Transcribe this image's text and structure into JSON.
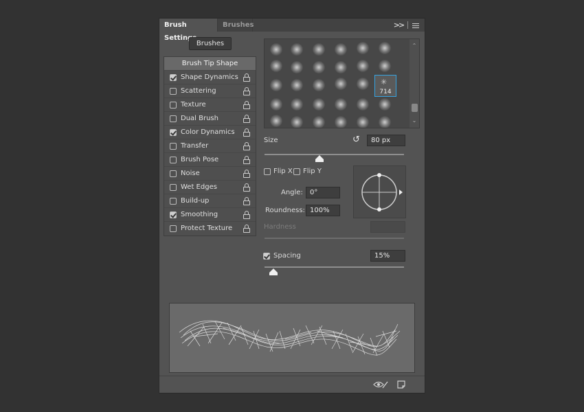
{
  "tabs": {
    "active": "Brush Settings",
    "inactive": "Brushes"
  },
  "brushes_button": "Brushes",
  "options_header": "Brush Tip Shape",
  "options": [
    {
      "label": "Shape Dynamics",
      "checked": true
    },
    {
      "label": "Scattering",
      "checked": false
    },
    {
      "label": "Texture",
      "checked": false
    },
    {
      "label": "Dual Brush",
      "checked": false
    },
    {
      "label": "Color Dynamics",
      "checked": true
    },
    {
      "label": "Transfer",
      "checked": false
    },
    {
      "label": "Brush Pose",
      "checked": false
    },
    {
      "label": "Noise",
      "checked": false
    },
    {
      "label": "Wet Edges",
      "checked": false
    },
    {
      "label": "Build-up",
      "checked": false
    },
    {
      "label": "Smoothing",
      "checked": true
    },
    {
      "label": "Protect Texture",
      "checked": false
    }
  ],
  "selected_tip": "714",
  "size": {
    "label": "Size",
    "value": "80 px"
  },
  "flip": {
    "x_label": "Flip X",
    "y_label": "Flip Y",
    "x_checked": false,
    "y_checked": false
  },
  "angle": {
    "label": "Angle:",
    "value": "0°"
  },
  "roundness": {
    "label": "Roundness:",
    "value": "100%"
  },
  "hardness": {
    "label": "Hardness",
    "value": ""
  },
  "spacing": {
    "label": "Spacing",
    "value": "15%",
    "checked": true
  },
  "icons": {
    "collapse": "double-chevron-right-icon",
    "menu": "hamburger-menu-icon",
    "reset": "reset-icon",
    "lock": "lock-icon",
    "toggle_preview": "eye-icon",
    "new_preset": "new-preset-icon"
  },
  "colors": {
    "selection_accent": "#36a3e0",
    "panel": "#535353",
    "background": "#323232"
  }
}
